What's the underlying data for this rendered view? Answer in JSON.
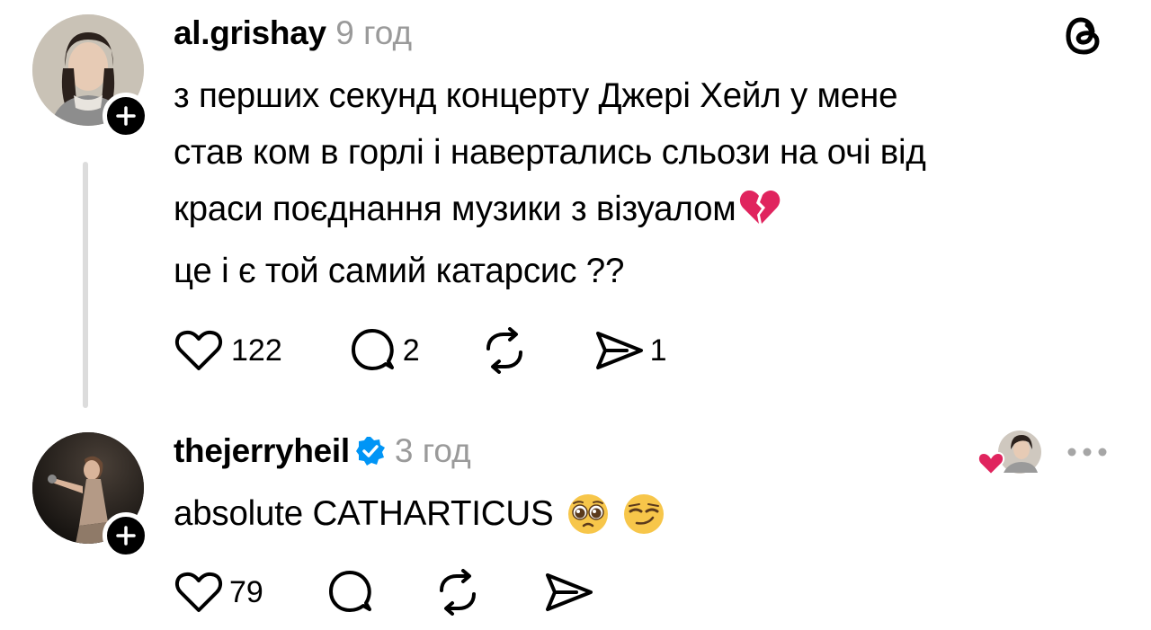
{
  "post": {
    "username": "al.grishay",
    "time": "9 год",
    "lines": [
      "з перших секунд концерту Джері Хейл у мене",
      "став ком в горлі і навертались сльози на очі від",
      "краси поєднання музики з візуалом",
      "це і є той самий катарсис ??"
    ],
    "line3_emoji": "broken-heart",
    "likes": "122",
    "comments": "2",
    "shares": "1"
  },
  "reply": {
    "username": "thejerryheil",
    "verified": true,
    "time": "3 год",
    "text": "absolute CATHARTICUS",
    "emojis": [
      "pleading-face",
      "smirking-face"
    ],
    "likes": "79",
    "liked_by_author_badge": "heart-with-avatar"
  },
  "app": {
    "logo_icon": "threads-logo-icon"
  },
  "colors": {
    "verified": "#0095f6",
    "heart": "#e0245e",
    "muted": "#9a9a9a"
  }
}
